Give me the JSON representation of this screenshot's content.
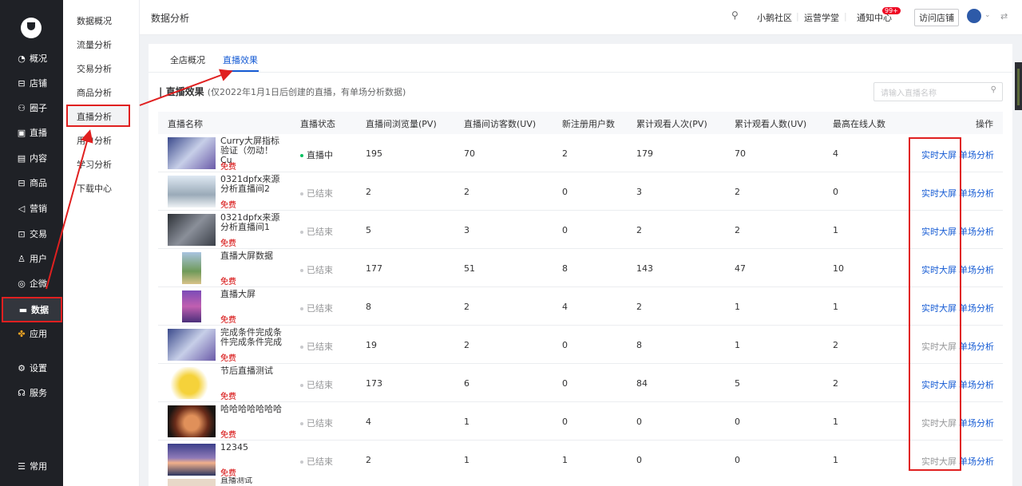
{
  "nav": {
    "items": [
      {
        "icon": "◔",
        "label": "概况"
      },
      {
        "icon": "⊟",
        "label": "店铺"
      },
      {
        "icon": "⚇",
        "label": "圈子"
      },
      {
        "icon": "▣",
        "label": "直播"
      },
      {
        "icon": "▤",
        "label": "内容"
      },
      {
        "icon": "⊟",
        "label": "商品"
      },
      {
        "icon": "◁",
        "label": "营销"
      },
      {
        "icon": "⊡",
        "label": "交易"
      },
      {
        "icon": "♙",
        "label": "用户"
      },
      {
        "icon": "◎",
        "label": "企微"
      },
      {
        "icon": "▬",
        "label": "数据"
      },
      {
        "icon": "✤",
        "label": "应用"
      },
      {
        "icon": "⚙",
        "label": "设置"
      },
      {
        "icon": "☊",
        "label": "服务"
      },
      {
        "icon": "☰",
        "label": "常用"
      }
    ]
  },
  "subnav": {
    "items": [
      "数据概况",
      "流量分析",
      "交易分析",
      "商品分析",
      "直播分析",
      "用户分析",
      "学习分析",
      "下载中心"
    ]
  },
  "header": {
    "title": "数据分析",
    "community": "小鹅社区",
    "school": "运营学堂",
    "notice": "通知中心",
    "badge": "99+",
    "visit": "访问店铺"
  },
  "tabs": [
    "全店概况",
    "直播效果"
  ],
  "section": {
    "title": "直播效果",
    "note": "(仅2022年1月1日后创建的直播，有单场分析数据)",
    "search_placeholder": "请输入直播名称"
  },
  "table": {
    "headers": [
      "直播名称",
      "直播状态",
      "直播间浏览量(PV)",
      "直播间访客数(UV)",
      "新注册用户数",
      "累计观看人次(PV)",
      "累计观看人数(UV)",
      "最高在线人数",
      "操作"
    ],
    "rows": [
      {
        "name": "Curry大屏指标验证（勿动！Cu",
        "price": "免费",
        "status": "直播中",
        "pv": "195",
        "uv": "70",
        "reg": "2",
        "wpv": "179",
        "wuv": "70",
        "peak": "4",
        "op1": "实时大屏",
        "op2": "单场分析"
      },
      {
        "name": "0321dpfx来源分析直播间2",
        "price": "免费",
        "status": "已结束",
        "pv": "2",
        "uv": "2",
        "reg": "0",
        "wpv": "3",
        "wuv": "2",
        "peak": "0",
        "op1": "实时大屏",
        "op2": "单场分析"
      },
      {
        "name": "0321dpfx来源分析直播间1",
        "price": "免费",
        "status": "已结束",
        "pv": "5",
        "uv": "3",
        "reg": "0",
        "wpv": "2",
        "wuv": "2",
        "peak": "1",
        "op1": "实时大屏",
        "op2": "单场分析"
      },
      {
        "name": "直播大屏数据",
        "price": "免费",
        "status": "已结束",
        "pv": "177",
        "uv": "51",
        "reg": "8",
        "wpv": "143",
        "wuv": "47",
        "peak": "10",
        "op1": "实时大屏",
        "op2": "单场分析"
      },
      {
        "name": "直播大屏",
        "price": "免费",
        "status": "已结束",
        "pv": "8",
        "uv": "2",
        "reg": "4",
        "wpv": "2",
        "wuv": "1",
        "peak": "1",
        "op1": "实时大屏",
        "op2": "单场分析"
      },
      {
        "name": "完成条件完成条件完成条件完成",
        "price": "免费",
        "status": "已结束",
        "pv": "19",
        "uv": "2",
        "reg": "0",
        "wpv": "8",
        "wuv": "1",
        "peak": "2",
        "op1": "实时大屏",
        "op2": "单场分析"
      },
      {
        "name": "节后直播测试",
        "price": "免费",
        "status": "已结束",
        "pv": "173",
        "uv": "6",
        "reg": "0",
        "wpv": "84",
        "wuv": "5",
        "peak": "2",
        "op1": "实时大屏",
        "op2": "单场分析"
      },
      {
        "name": "哈哈哈哈哈哈哈",
        "price": "免费",
        "status": "已结束",
        "pv": "4",
        "uv": "1",
        "reg": "0",
        "wpv": "0",
        "wuv": "0",
        "peak": "1",
        "op1": "实时大屏",
        "op2": "单场分析"
      },
      {
        "name": "12345",
        "price": "免费",
        "status": "已结束",
        "pv": "2",
        "uv": "1",
        "reg": "1",
        "wpv": "0",
        "wuv": "0",
        "peak": "1",
        "op1": "实时大屏",
        "op2": "单场分析"
      }
    ],
    "partial_row_name": "直播测试"
  }
}
